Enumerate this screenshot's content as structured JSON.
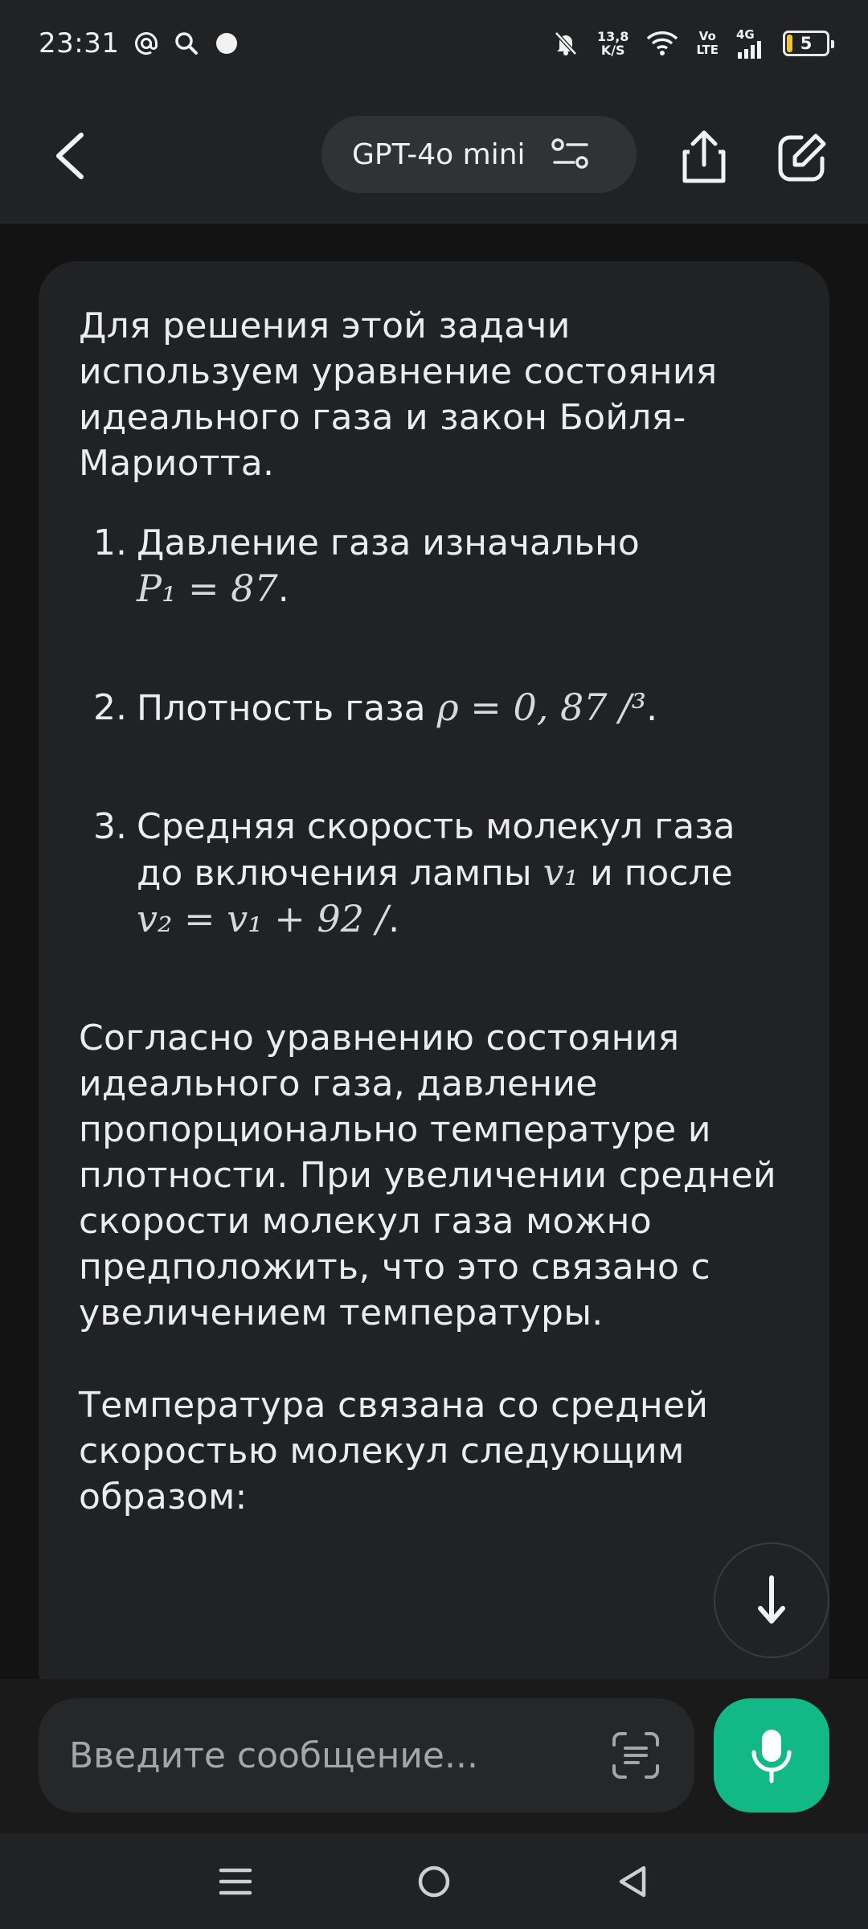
{
  "status_bar": {
    "time": "23:31",
    "net_speed_value": "13,8",
    "net_speed_unit": "K/S",
    "volte_top": "Vo",
    "volte_bottom": "LTE",
    "network": "4G",
    "battery": "5"
  },
  "header": {
    "model_name": "GPT-4o mini"
  },
  "message": {
    "intro": "Для решения этой задачи используем уравнение состояния идеального газа и закон Бойля-Мариотта.",
    "items": [
      {
        "num": "1.",
        "text": "Давление газа изначально ",
        "math": "P₁ = 87",
        "suffix": "."
      },
      {
        "num": "2.",
        "text": "Плотность газа ",
        "math": "ρ = 0, 87 /³",
        "suffix": "."
      },
      {
        "num": "3.",
        "text": "Средняя скорость молекул газа до включения лампы ",
        "math_a": "v₁",
        "text_b": " и после ",
        "math_b": "v₂ = v₁ + 92 /",
        "suffix": "."
      }
    ],
    "paragraph_2": "Согласно уравнению состояния идеального газа, давление пропорционально температуре и плотности. При увеличении средней скорости молекул газа можно предположить, что это связано с увеличением температуры.",
    "paragraph_3": "Температура связана со средней скоростью молекул следующим образом:"
  },
  "composer": {
    "placeholder": "Введите сообщение..."
  },
  "colors": {
    "accent": "#12b886",
    "background": "#131313",
    "card": "#212224",
    "battery_low": "#f1c232"
  }
}
